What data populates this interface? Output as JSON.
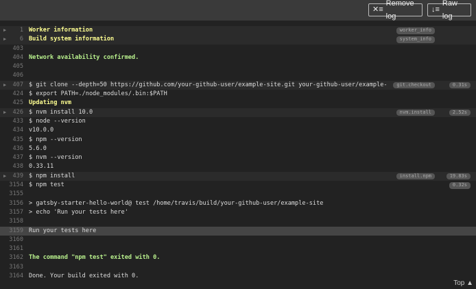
{
  "header": {
    "remove_log": "Remove log",
    "raw_log": "Raw log"
  },
  "rows": [
    {
      "n": "1",
      "t": "Worker information",
      "s": "y",
      "fold": true,
      "tag": "worker_info"
    },
    {
      "n": "6",
      "t": "Build system information",
      "s": "y",
      "fold": true,
      "tag": "system_info"
    },
    {
      "n": "403",
      "t": ""
    },
    {
      "n": "404",
      "t": "Network availability confirmed.",
      "s": "g"
    },
    {
      "n": "405",
      "t": ""
    },
    {
      "n": "406",
      "t": ""
    },
    {
      "n": "407",
      "t": "$ git clone --depth=50 https://github.com/your-github-user/example-site.git your-github-user/example-",
      "fold": true,
      "tag": "git.checkout",
      "time": "0.31s"
    },
    {
      "n": "424",
      "t": "$ export PATH=./node_modules/.bin:$PATH"
    },
    {
      "n": "425",
      "t": "Updating nvm",
      "s": "y"
    },
    {
      "n": "426",
      "t": "$ nvm install 10.0",
      "fold": true,
      "tag": "nvm.install",
      "time": "2.52s"
    },
    {
      "n": "433",
      "t": "$ node --version"
    },
    {
      "n": "434",
      "t": "v10.0.0"
    },
    {
      "n": "435",
      "t": "$ npm --version"
    },
    {
      "n": "436",
      "t": "5.6.0"
    },
    {
      "n": "437",
      "t": "$ nvm --version"
    },
    {
      "n": "438",
      "t": "0.33.11"
    },
    {
      "n": "439",
      "t": "$ npm install",
      "fold": true,
      "tag": "install.npm",
      "time": "19.83s"
    },
    {
      "n": "3154",
      "t": "$ npm test",
      "time": "0.32s"
    },
    {
      "n": "3155",
      "t": ""
    },
    {
      "n": "3156",
      "t": "> gatsby-starter-hello-world@ test /home/travis/build/your-github-user/example-site"
    },
    {
      "n": "3157",
      "t": "> echo 'Run your tests here'"
    },
    {
      "n": "3158",
      "t": ""
    },
    {
      "n": "3159",
      "t": "Run your tests here",
      "hl": true
    },
    {
      "n": "3160",
      "t": ""
    },
    {
      "n": "3161",
      "t": ""
    },
    {
      "n": "3162",
      "t": "The command \"npm test\" exited with 0.",
      "s": "g"
    },
    {
      "n": "3163",
      "t": ""
    },
    {
      "n": "3164",
      "t": "Done. Your build exited with 0."
    }
  ],
  "footer": {
    "top": "Top"
  }
}
